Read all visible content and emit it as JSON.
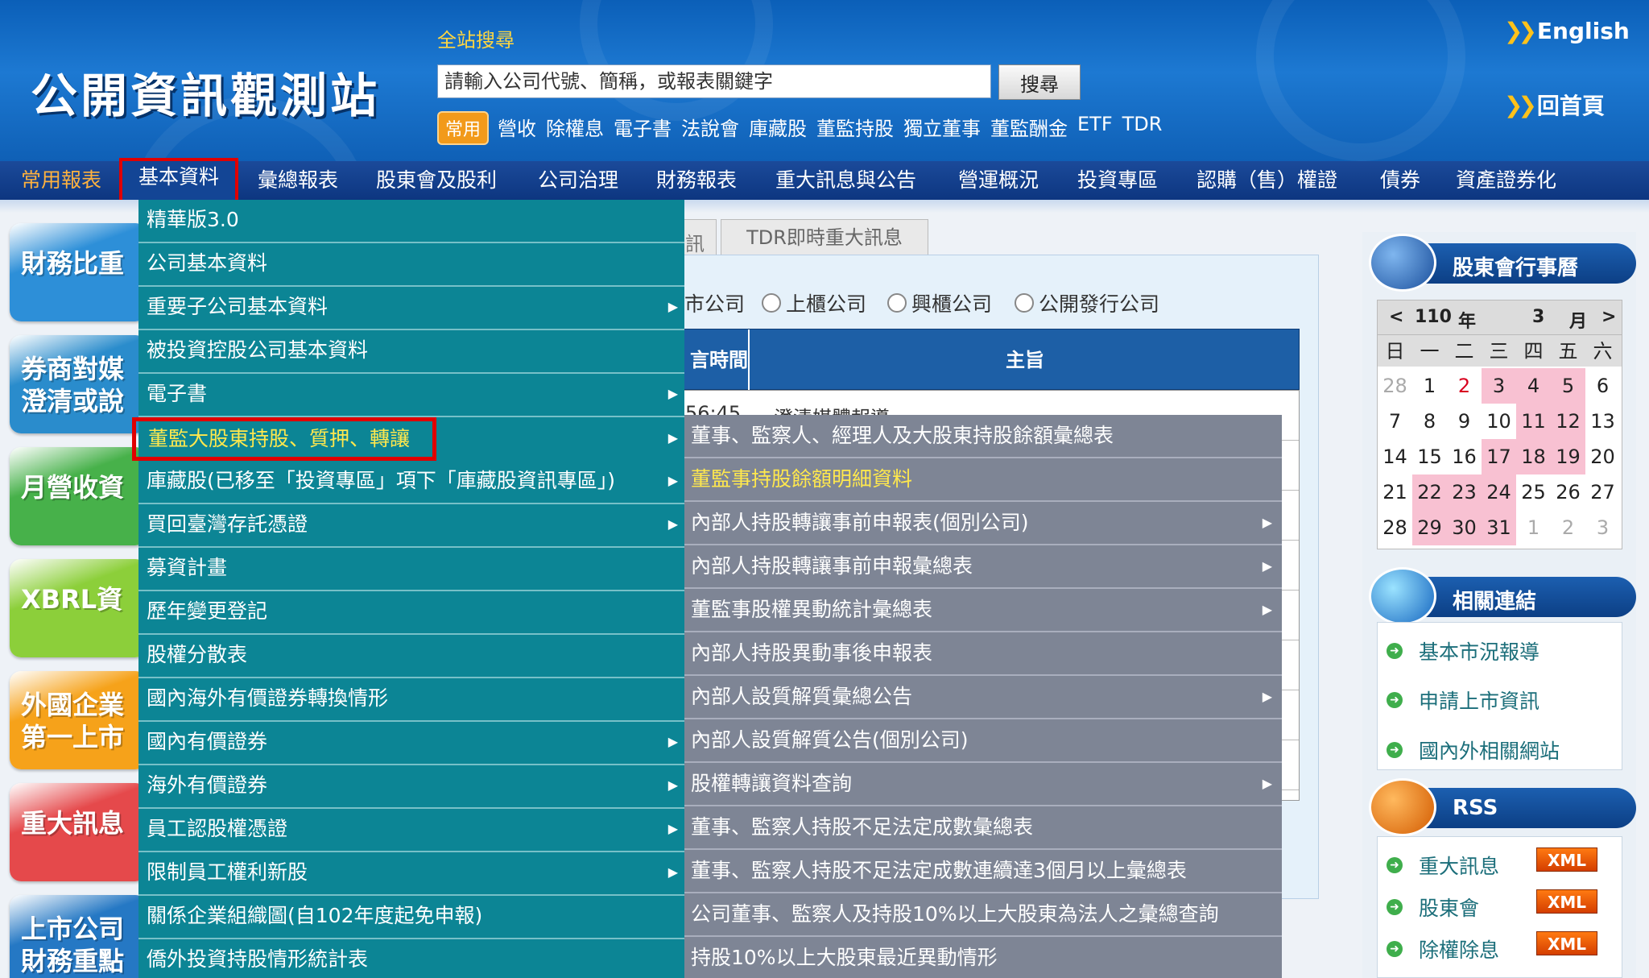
{
  "header": {
    "logo": "公開資訊觀測站",
    "search_label": "全站搜尋",
    "search_placeholder": "請輸入公司代號、簡稱，或報表關鍵字",
    "search_button": "搜尋",
    "quick_badge": "常用",
    "quick_links": [
      "營收",
      "除權息",
      "電子書",
      "法說會",
      "庫藏股",
      "董監持股",
      "獨立董事",
      "董監酬金",
      "ETF",
      "TDR"
    ],
    "english": "English",
    "home": "回首頁"
  },
  "nav": {
    "items": [
      "常用報表",
      "基本資料",
      "彙總報表",
      "股東會及股利",
      "公司治理",
      "財務報表",
      "重大訊息與公告",
      "營運概況",
      "投資專區",
      "認購（售）權證",
      "債券",
      "資產證券化"
    ],
    "active_index": 1
  },
  "left_badges": [
    {
      "label": "財務比重",
      "color": "#2d8fd8"
    },
    {
      "label": "券商對媒",
      "label2": "澄清或說",
      "color": "#2a8ccc"
    },
    {
      "label": "月營收資",
      "color": "#47b14a"
    },
    {
      "label": "XBRL資",
      "color": "#8ccf3a"
    },
    {
      "label": "外國企業",
      "label2": "第一上市",
      "color": "#f6a21a"
    },
    {
      "label": "重大訊息",
      "color": "#e5494b"
    },
    {
      "label": "上市公司",
      "label2": "財務重點",
      "color": "#2578c4"
    }
  ],
  "content": {
    "tab_partial": "訊",
    "tab2": "TDR即時重大訊息",
    "radios": [
      "市公司",
      "上櫃公司",
      "興櫃公司",
      "公開發行公司"
    ],
    "col_time": "言時間",
    "col_subject": "主旨",
    "rows": [
      {
        "time": "56:45",
        "subject": "澄清媒體報導"
      }
    ]
  },
  "menu_main": [
    {
      "label": "精華版3.0",
      "sub": false
    },
    {
      "label": "公司基本資料",
      "sub": false
    },
    {
      "label": "重要子公司基本資料",
      "sub": true
    },
    {
      "label": "被投資控股公司基本資料",
      "sub": false
    },
    {
      "label": "電子書",
      "sub": true
    },
    {
      "label": "董監大股東持股、質押、轉讓",
      "sub": true,
      "selected": true
    },
    {
      "label": "庫藏股(已移至「投資專區」項下「庫藏股資訊專區」)",
      "sub": true
    },
    {
      "label": "買回臺灣存託憑證",
      "sub": true
    },
    {
      "label": "募資計畫",
      "sub": false
    },
    {
      "label": "歷年變更登記",
      "sub": false
    },
    {
      "label": "股權分散表",
      "sub": false
    },
    {
      "label": "國內海外有價證券轉換情形",
      "sub": false
    },
    {
      "label": "國內有價證券",
      "sub": true
    },
    {
      "label": "海外有價證券",
      "sub": true
    },
    {
      "label": "員工認股權憑證",
      "sub": true
    },
    {
      "label": "限制員工權利新股",
      "sub": true
    },
    {
      "label": "關係企業組織圖(自102年度起免申報)",
      "sub": false
    },
    {
      "label": "僑外投資持股情形統計表",
      "sub": false
    }
  ],
  "menu_sub": [
    {
      "label": "董事、監察人、經理人及大股東持股餘額彙總表",
      "sub": false
    },
    {
      "label": "董監事持股餘額明細資料",
      "sub": false,
      "highlight": true
    },
    {
      "label": "內部人持股轉讓事前申報表(個別公司)",
      "sub": true
    },
    {
      "label": "內部人持股轉讓事前申報彙總表",
      "sub": true
    },
    {
      "label": "董監事股權異動統計彙總表",
      "sub": true
    },
    {
      "label": "內部人持股異動事後申報表",
      "sub": false
    },
    {
      "label": "內部人設質解質彙總公告",
      "sub": true
    },
    {
      "label": "內部人設質解質公告(個別公司)",
      "sub": false
    },
    {
      "label": "股權轉讓資料查詢",
      "sub": true
    },
    {
      "label": "董事、監察人持股不足法定成數彙總表",
      "sub": false
    },
    {
      "label": "董事、監察人持股不足法定成數連續達3個月以上彙總表",
      "sub": false
    },
    {
      "label": "公司董事、監察人及持股10%以上大股東為法人之彙總查詢",
      "sub": false
    },
    {
      "label": "持股10%以上大股東最近異動情形",
      "sub": false
    }
  ],
  "sidebar": {
    "calendar_title": "股東會行事曆",
    "prev": "<",
    "next": ">",
    "year": "110",
    "year_unit": "年",
    "month": "3",
    "month_unit": "月",
    "weekdays": [
      "日",
      "一",
      "二",
      "三",
      "四",
      "五",
      "六"
    ],
    "weeks": [
      [
        "28",
        "1",
        "2",
        "3",
        "4",
        "5",
        "6"
      ],
      [
        "7",
        "8",
        "9",
        "10",
        "11",
        "12",
        "13"
      ],
      [
        "14",
        "15",
        "16",
        "17",
        "18",
        "19",
        "20"
      ],
      [
        "21",
        "22",
        "23",
        "24",
        "25",
        "26",
        "27"
      ],
      [
        "28",
        "29",
        "30",
        "31",
        "1",
        "2",
        "3"
      ]
    ],
    "links_title": "相關連結",
    "links": [
      "基本市況報導",
      "申請上市資訊",
      "國內外相關網站"
    ],
    "rss_title": "RSS",
    "rss_items": [
      "重大訊息",
      "股東會",
      "除權除息"
    ],
    "xml_label": "XML"
  }
}
